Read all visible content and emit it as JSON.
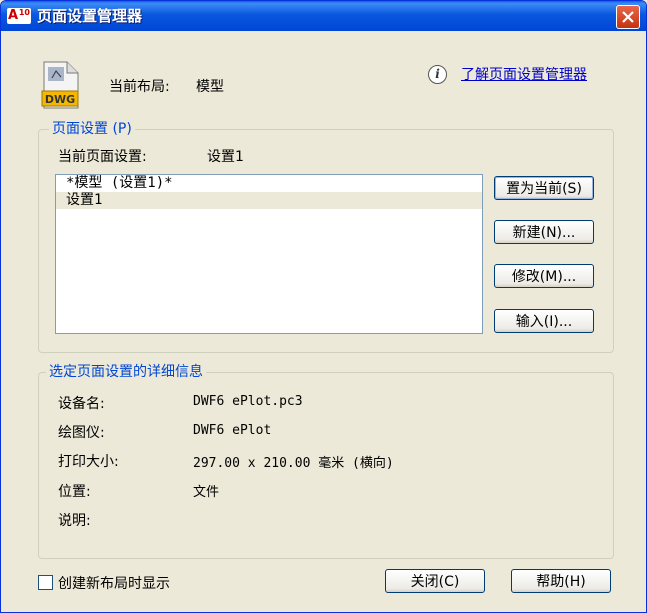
{
  "window": {
    "title": "页面设置管理器",
    "app_icon_text": "A",
    "app_icon_version": "10"
  },
  "header": {
    "file_icon_text": "DWG",
    "current_layout_label": "当前布局:",
    "current_layout_value": "模型",
    "learn_link": "了解页面设置管理器"
  },
  "page_setup": {
    "group_title": "页面设置 (P)",
    "current_label": "当前页面设置:",
    "current_value": "设置1",
    "list": [
      "*模型 (设置1)*",
      "设置1"
    ],
    "buttons": {
      "set_current": "置为当前(S)",
      "new": "新建(N)...",
      "modify": "修改(M)...",
      "import": "输入(I)..."
    }
  },
  "details": {
    "group_title": "选定页面设置的详细信息",
    "rows": [
      {
        "label": "设备名:",
        "value": "DWF6 ePlot.pc3"
      },
      {
        "label": "绘图仪:",
        "value": "DWF6 ePlot"
      },
      {
        "label": "打印大小:",
        "value": "297.00 x 210.00 毫米 (横向)"
      },
      {
        "label": "位置:",
        "value": "文件"
      },
      {
        "label": "说明:",
        "value": ""
      }
    ]
  },
  "footer": {
    "checkbox_label": "创建新布局时显示",
    "checkbox_checked": false,
    "close": "关闭(C)",
    "help": "帮助(H)"
  },
  "colors": {
    "titlebar": "#0058e6",
    "group_title": "#0046d5",
    "link": "#0000cc",
    "close_button": "#d54a2a"
  }
}
